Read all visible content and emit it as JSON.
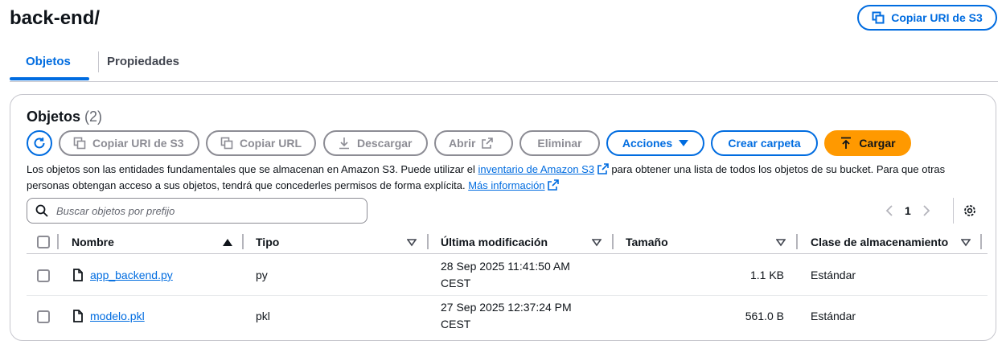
{
  "header": {
    "title": "back-end/",
    "copy_uri_label": "Copiar URI de S3"
  },
  "tabs": [
    {
      "label": "Objetos"
    },
    {
      "label": "Propiedades"
    }
  ],
  "panel": {
    "title": "Objetos",
    "count": "(2)",
    "toolbar": {
      "copy_uri": "Copiar URI de S3",
      "copy_url": "Copiar URL",
      "download": "Descargar",
      "open": "Abrir",
      "delete": "Eliminar",
      "actions": "Acciones",
      "create_folder": "Crear carpeta",
      "upload": "Cargar"
    },
    "description": {
      "part1": "Los objetos son las entidades fundamentales que se almacenan en Amazon S3. Puede utilizar el ",
      "link1": "inventario de Amazon S3",
      "part2": " para obtener una lista de todos los objetos de su bucket. Para que otras personas obtengan acceso a sus objetos, tendrá que concederles permisos de forma explícita. ",
      "link2": "Más información"
    },
    "search_placeholder": "Buscar objetos por prefijo",
    "pagination": {
      "page": "1"
    },
    "columns": {
      "name": "Nombre",
      "type": "Tipo",
      "modified": "Última modificación",
      "size": "Tamaño",
      "storage": "Clase de almacenamiento"
    },
    "rows": [
      {
        "name": "app_backend.py",
        "type": "py",
        "modified_1": "28 Sep 2025 11:41:50 AM",
        "modified_2": "CEST",
        "size": "1.1 KB",
        "storage": "Estándar"
      },
      {
        "name": "modelo.pkl",
        "type": "pkl",
        "modified_1": "27 Sep 2025 12:37:24 PM",
        "modified_2": "CEST",
        "size": "561.0 B",
        "storage": "Estándar"
      }
    ]
  },
  "colors": {
    "accent": "#006ce0",
    "upload": "#ff9900",
    "disabled": "#8c8c94"
  }
}
